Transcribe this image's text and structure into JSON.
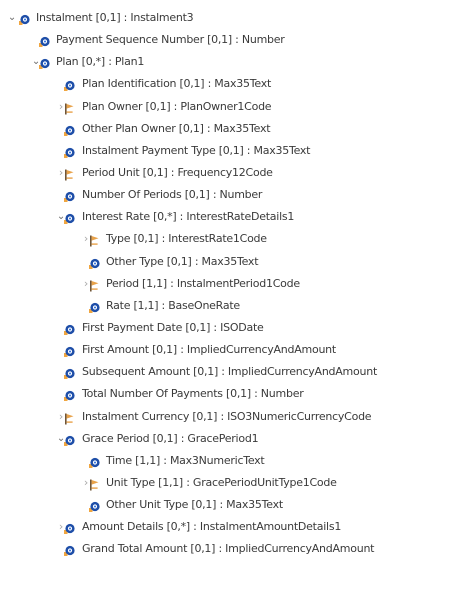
{
  "tree": [
    {
      "depth": 0,
      "toggle": "expanded",
      "icon": "element-icon",
      "label": "Instalment [0,1] : Instalment3"
    },
    {
      "depth": 1,
      "toggle": "none",
      "icon": "element-icon",
      "label": "Payment Sequence Number [0,1] : Number"
    },
    {
      "depth": 1,
      "toggle": "expanded",
      "icon": "element-icon",
      "label": "Plan [0,*] : Plan1"
    },
    {
      "depth": 2,
      "toggle": "none",
      "icon": "element-icon",
      "label": "Plan Identification [0,1] : Max35Text"
    },
    {
      "depth": 2,
      "toggle": "collapsed",
      "icon": "code-icon",
      "label": "Plan Owner [0,1] : PlanOwner1Code"
    },
    {
      "depth": 2,
      "toggle": "none",
      "icon": "element-icon",
      "label": "Other Plan Owner [0,1] : Max35Text"
    },
    {
      "depth": 2,
      "toggle": "none",
      "icon": "element-icon",
      "label": "Instalment Payment Type [0,1] : Max35Text"
    },
    {
      "depth": 2,
      "toggle": "collapsed",
      "icon": "code-icon",
      "label": "Period Unit [0,1] : Frequency12Code"
    },
    {
      "depth": 2,
      "toggle": "none",
      "icon": "element-icon",
      "label": "Number Of Periods [0,1] : Number"
    },
    {
      "depth": 2,
      "toggle": "expanded",
      "icon": "element-icon",
      "label": "Interest Rate [0,*] : InterestRateDetails1"
    },
    {
      "depth": 3,
      "toggle": "collapsed",
      "icon": "code-icon",
      "label": "Type [0,1] : InterestRate1Code"
    },
    {
      "depth": 3,
      "toggle": "none",
      "icon": "element-icon",
      "label": "Other Type [0,1] : Max35Text"
    },
    {
      "depth": 3,
      "toggle": "collapsed",
      "icon": "code-icon",
      "label": "Period [1,1] : InstalmentPeriod1Code"
    },
    {
      "depth": 3,
      "toggle": "none",
      "icon": "element-icon",
      "label": "Rate [1,1] : BaseOneRate"
    },
    {
      "depth": 2,
      "toggle": "none",
      "icon": "element-icon",
      "label": "First Payment Date [0,1] : ISODate"
    },
    {
      "depth": 2,
      "toggle": "none",
      "icon": "element-icon",
      "label": "First Amount [0,1] : ImpliedCurrencyAndAmount"
    },
    {
      "depth": 2,
      "toggle": "none",
      "icon": "element-icon",
      "label": "Subsequent Amount [0,1] : ImpliedCurrencyAndAmount"
    },
    {
      "depth": 2,
      "toggle": "none",
      "icon": "element-icon",
      "label": "Total Number Of Payments [0,1] : Number"
    },
    {
      "depth": 2,
      "toggle": "collapsed",
      "icon": "code-icon",
      "label": "Instalment Currency [0,1] : ISO3NumericCurrencyCode"
    },
    {
      "depth": 2,
      "toggle": "expanded",
      "icon": "element-icon",
      "label": "Grace Period [0,1] : GracePeriod1"
    },
    {
      "depth": 3,
      "toggle": "none",
      "icon": "element-icon",
      "label": "Time [1,1] : Max3NumericText"
    },
    {
      "depth": 3,
      "toggle": "collapsed",
      "icon": "code-icon",
      "label": "Unit Type [1,1] : GracePeriodUnitType1Code"
    },
    {
      "depth": 3,
      "toggle": "none",
      "icon": "element-icon",
      "label": "Other Unit Type [0,1] : Max35Text"
    },
    {
      "depth": 2,
      "toggle": "collapsed",
      "icon": "element-icon",
      "label": "Amount Details [0,*] : InstalmentAmountDetails1"
    },
    {
      "depth": 2,
      "toggle": "none",
      "icon": "element-icon",
      "label": "Grand Total Amount [0,1] : ImpliedCurrencyAndAmount"
    }
  ],
  "icons": {
    "element-icon": {
      "ring": "#1e4ea8",
      "core": "#2e6fdc",
      "tag": "#f0a640"
    },
    "code-icon": {
      "stem": "#6f5537",
      "flag": "#e8a24a"
    }
  },
  "toggle_glyphs": {
    "expanded": "⌄",
    "collapsed": "›"
  }
}
